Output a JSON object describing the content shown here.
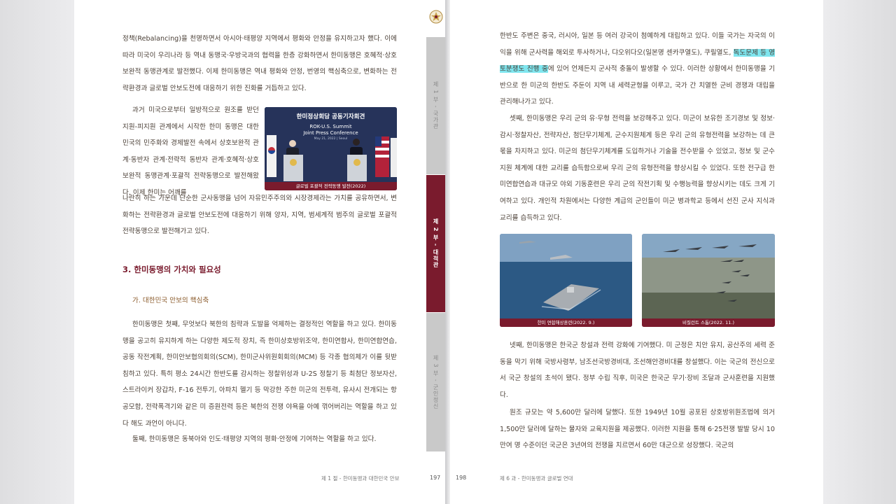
{
  "left_page": {
    "para1": "정책(Rebalancing)을 천명하면서 아시아·태평양 지역에서 평화와 안정을 유지하고자 했다. 이에 따라 미국이 우리나라 등 역내 동맹국·우방국과의 협력을 한층 강화하면서 한미동맹은 호혜적·상호보완적 동맹관계로 발전했다. 이제 한미동맹은 역내 평화와 안정, 번영의 핵심축으로, 변화하는 전략환경과 글로벌 안보도전에 대응하기 위한 진화를 거듭하고 있다.",
    "para2_wrap": "과거 미국으로부터 일방적으로 원조를 받던 지원-피지원 관계에서 시작한 한미 동맹은 대한민국의 민주화와 경제발전 속에서 상호보완적 관계·동반자 관계·전략적 동반자 관계·호혜적·상호보완적 동맹관계·포괄적 전략동맹으로 발전해왔다. 이제 한미는 어깨를",
    "para2_rest": "나란히 하는 가운데 단순한 군사동맹을 넘어 자유민주주의와 시장경제라는 가치를 공유하면서, 변화하는 전략환경과 글로벌 안보도전에 대응하기 위해 양자, 지역, 범세계적 범주의 글로벌 포괄적 전략동맹으로 발전해가고 있다.",
    "heading": "3. 한미동맹의 가치와 필요성",
    "subheading": "가. 대한민국 안보의 핵심축",
    "para3": "한미동맹은 첫째, 무엇보다 북한의 침략과 도발을 억제하는 결정적인 역할을 하고 있다. 한미동맹을 공고히 유지하게 하는 다양한 제도적 장치, 즉 한미상호방위조약, 한미연합사, 한미연합연습, 공동 작전계획, 한미안보협의회의(SCM), 한미군사위원회회의(MCM) 등 각종 협의체가 이를 뒷받침하고 있다. 특히 평소 24시간 한반도를 감시하는 정찰위성과 U-2S 정찰기 등 최첨단 정보자산, 스트라이커 장갑차, F-16 전투기, 아파치 헬기 등 막강한 주한 미군의 전투력, 유사시 전개되는 항공모함, 전략폭격기와 같은 미 증원전력 등은 북한의 전쟁 야욕을 아예 꺾어버리는 역할을 하고 있다 해도 과언이 아니다.",
    "para4": "둘째, 한미동맹은 동북아와 인도·태평양 지역의 평화·안정에 기여하는 역할을 하고 있다.",
    "footer": "제 1 절 - 한미동맹과 대한민국 안보",
    "page_number": "197",
    "photo": {
      "title": "한미정상회담 공동기자회견",
      "subtitle1": "ROK-U.S. Summit",
      "subtitle2": "Joint Press Conference",
      "date": "May 21, 2022 | Seoul",
      "caption": "글로벌 포괄적 전략동맹 발전(2022)"
    },
    "tabs": [
      "제 1 부 - 국가관",
      "제 2 부 - 대적관",
      "제 3 부 - 군인정신"
    ]
  },
  "right_page": {
    "para1_a": "한반도 주변은 중국, 러시아, 일본 등 여러 강국이 첨예하게 대립하고 있다. 이들 국가는 자국의 이익을 위해 군사력을 해외로 투사하거나, 댜오위다오(일본명 센카쿠열도), 쿠릴열도,",
    "para1_highlight": "독도문제 등 영토분쟁도 진행 중",
    "para1_b": "에 있어 언제든지 군사적 충돌이 발생할 수 있다. 이러한 상황에서 한미동맹을 기반으로 한 미군의 한반도 주둔이 지역 내 세력균형을 이루고, 국가 간 치열한 군비 경쟁과 대립을 관리해나가고 있다.",
    "para2": "셋째, 한미동맹은 우리 군의 유·무형 전력을 보강해주고 있다. 미군이 보유한 조기경보 및 정보·감시·정찰자산, 전략자산, 첨단무기체계, 군수지원체계 등은 우리 군의 유형전력을 보강하는 데 큰 몫을 차지하고 있다. 미군의 첨단무기체계를 도입하거나 기술을 전수받을 수 있었고, 정보 및 군수지원 체계에 대한 교리를 습득함으로써 우리 군의 유형전력을 향상시킬 수 있었다. 또한 전구급 한미연합연습과 대규모 야외 기동훈련은 우리 군의 작전기획 및 수행능력을 향상시키는 데도 크게 기여하고 있다. 개인적 차원에서는 다양한 계급의 군인들이 미군 병과학교 등에서 선진 군사 지식과 교리를 습득하고 있다.",
    "photo_left_caption": "한미 연합해상훈련(2022. 9.)",
    "photo_right_caption": "비질런트 스톰(2022. 11.)",
    "para3": "넷째, 한미동맹은 한국군 창설과 전력 강화에 기여했다. 미 군정은 치안 유지, 공산주의 세력 준동을 막기 위해 국방사령부, 남조선국방경비대, 조선해안경비대를 창설했다. 이는 국군의 전신으로서 국군 창설의 초석이 됐다. 정부 수립 직후, 미국은 한국군 무기·장비 조달과 군사훈련을 지원했다.",
    "para4": "원조 규모는 약 5,600만 달러에 달했다. 또한 1949년 10월 공포된 상호방위원조법에 의거 1,500만 달러에 달하는 물자와 교육지원을 제공했다. 이러한 지원을 통해 6·25전쟁 발발 당시 10만여 명 수준이던 국군은 3년여의 전쟁을 치르면서 60만 대군으로 성장했다. 국군의",
    "footer": "제 6 과 - 한미동맹과 글로벌 연대",
    "page_number": "198"
  }
}
